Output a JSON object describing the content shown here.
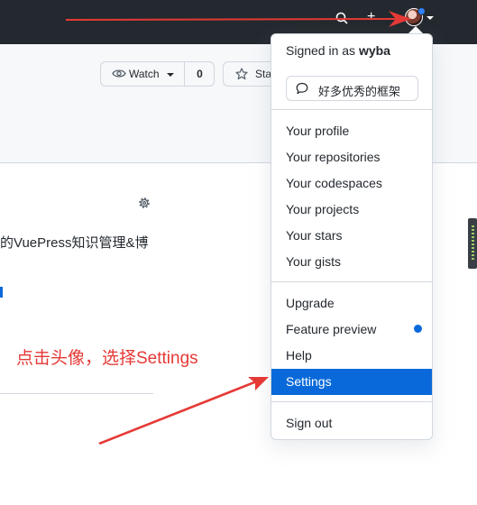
{
  "header": {
    "plus": "+"
  },
  "repo": {
    "watch_label": "Watch",
    "watch_count": "0",
    "star_label": "Sta",
    "about_text": "的VuePress知识管理&博"
  },
  "annotation": {
    "text": "点击头像，选择Settings",
    "color": "#e53935"
  },
  "dropdown": {
    "signed_prefix": "Signed in as ",
    "username": "wyba",
    "status_text": "好多优秀的框架",
    "items": [
      {
        "label": "Your profile"
      },
      {
        "label": "Your repositories"
      },
      {
        "label": "Your codespaces"
      },
      {
        "label": "Your projects"
      },
      {
        "label": "Your stars"
      },
      {
        "label": "Your gists"
      },
      {
        "label": "Upgrade"
      },
      {
        "label": "Feature preview"
      },
      {
        "label": "Help"
      },
      {
        "label": "Settings",
        "active": true
      },
      {
        "label": "Sign out"
      }
    ]
  },
  "colors": {
    "header_bg": "#24292f",
    "accent": "#0969da",
    "arrow": "#e53935"
  },
  "icons": [
    "search-icon",
    "plus-icon",
    "avatar",
    "eye-icon",
    "star-icon",
    "gear-icon",
    "speech-bubble-icon",
    "notification-dot"
  ]
}
